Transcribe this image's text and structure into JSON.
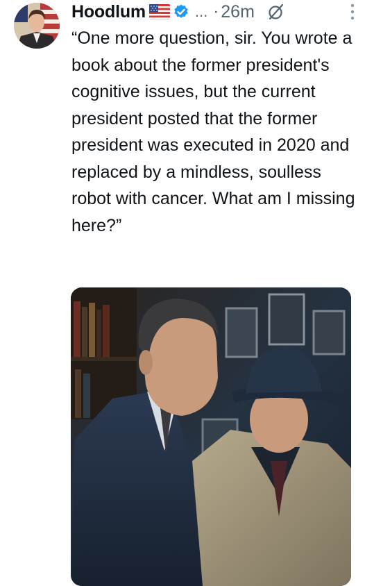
{
  "post": {
    "author": {
      "display_name": "Hoodlum",
      "flag_icon": "us-flag-icon",
      "verified_icon": "verified-badge-icon",
      "verified_color": "#1d9bf0"
    },
    "overflow_text": "...",
    "separator": "·",
    "timestamp": "26m",
    "text": "“One more question, sir. You wrote a book about the former president's cognitive issues, but the current president posted that the former president was executed in 2020 and replaced by a mindless, soulless robot with cancer. What am I missing here?”",
    "icons": {
      "grok": "slashed-circle-icon",
      "more": "vertical-dots-icon"
    },
    "media": {
      "type": "image",
      "description_icon": "photo"
    }
  }
}
